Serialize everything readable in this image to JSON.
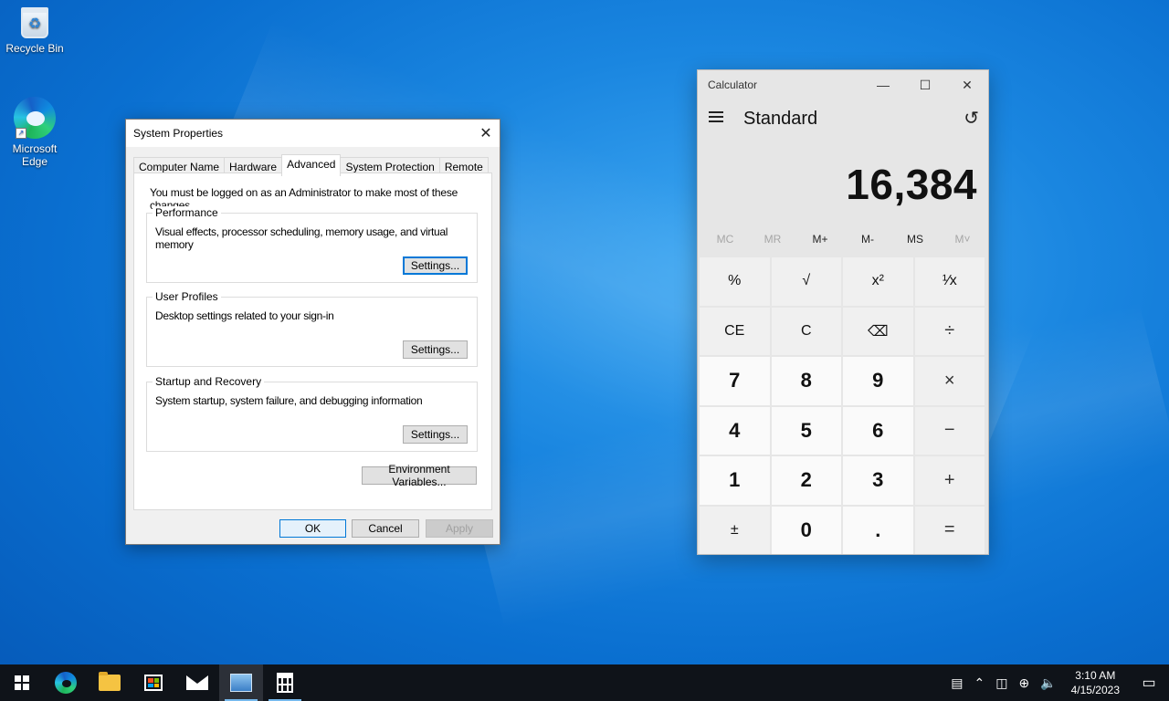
{
  "desktop": {
    "icons": [
      {
        "label": "Recycle Bin",
        "icon": "recycle-bin-icon"
      },
      {
        "label": "Microsoft Edge",
        "icon": "edge-icon"
      }
    ]
  },
  "system_properties": {
    "title": "System Properties",
    "close_glyph": "✕",
    "tabs": [
      "Computer Name",
      "Hardware",
      "Advanced",
      "System Protection",
      "Remote"
    ],
    "active_tab": "Advanced",
    "note": "You must be logged on as an Administrator to make most of these changes.",
    "groups": [
      {
        "label": "Performance",
        "description": "Visual effects, processor scheduling, memory usage, and virtual memory",
        "button": "Settings..."
      },
      {
        "label": "User Profiles",
        "description": "Desktop settings related to your sign-in",
        "button": "Settings..."
      },
      {
        "label": "Startup and Recovery",
        "description": "System startup, system failure, and debugging information",
        "button": "Settings..."
      }
    ],
    "env_button": "Environment Variables...",
    "ok": "OK",
    "cancel": "Cancel",
    "apply": "Apply"
  },
  "calculator": {
    "title": "Calculator",
    "mode": "Standard",
    "display": "16,384",
    "window_controls": {
      "minimize": "—",
      "maximize": "☐",
      "close": "✕"
    },
    "history_glyph": "↺",
    "memory": [
      {
        "label": "MC",
        "enabled": false
      },
      {
        "label": "MR",
        "enabled": false
      },
      {
        "label": "M+",
        "enabled": true
      },
      {
        "label": "M-",
        "enabled": true
      },
      {
        "label": "MS",
        "enabled": true
      },
      {
        "label": "M˅",
        "enabled": false
      }
    ],
    "keys": [
      {
        "label": "%",
        "kind": "fn",
        "name": "percent-key"
      },
      {
        "label": "√",
        "kind": "fn",
        "name": "sqrt-key"
      },
      {
        "label": "x²",
        "kind": "fn",
        "name": "square-key"
      },
      {
        "label": "¹⁄x",
        "kind": "fn",
        "name": "reciprocal-key"
      },
      {
        "label": "CE",
        "kind": "fn",
        "name": "clear-entry-key"
      },
      {
        "label": "C",
        "kind": "fn",
        "name": "clear-key"
      },
      {
        "label": "⌫",
        "kind": "fn",
        "name": "backspace-key"
      },
      {
        "label": "÷",
        "kind": "op",
        "name": "divide-key"
      },
      {
        "label": "7",
        "kind": "num",
        "name": "key-7"
      },
      {
        "label": "8",
        "kind": "num",
        "name": "key-8"
      },
      {
        "label": "9",
        "kind": "num",
        "name": "key-9"
      },
      {
        "label": "×",
        "kind": "op",
        "name": "multiply-key"
      },
      {
        "label": "4",
        "kind": "num",
        "name": "key-4"
      },
      {
        "label": "5",
        "kind": "num",
        "name": "key-5"
      },
      {
        "label": "6",
        "kind": "num",
        "name": "key-6"
      },
      {
        "label": "−",
        "kind": "op",
        "name": "subtract-key"
      },
      {
        "label": "1",
        "kind": "num",
        "name": "key-1"
      },
      {
        "label": "2",
        "kind": "num",
        "name": "key-2"
      },
      {
        "label": "3",
        "kind": "num",
        "name": "key-3"
      },
      {
        "label": "+",
        "kind": "op",
        "name": "add-key"
      },
      {
        "label": "±",
        "kind": "fn",
        "name": "negate-key"
      },
      {
        "label": "0",
        "kind": "num",
        "name": "key-0"
      },
      {
        "label": ".",
        "kind": "num",
        "name": "decimal-key"
      },
      {
        "label": "=",
        "kind": "op",
        "name": "equals-key"
      }
    ]
  },
  "taskbar": {
    "time": "3:10 AM",
    "date": "4/15/2023",
    "tray_glyphs": {
      "news": "▤",
      "chevron": "⌃",
      "meet": "◫",
      "network": "⊕",
      "volume": "🔈",
      "notification": "▭"
    }
  },
  "colors": {
    "accent": "#0078d7",
    "taskbar": "#0f1319",
    "running_indicator": "#76b9ed"
  }
}
